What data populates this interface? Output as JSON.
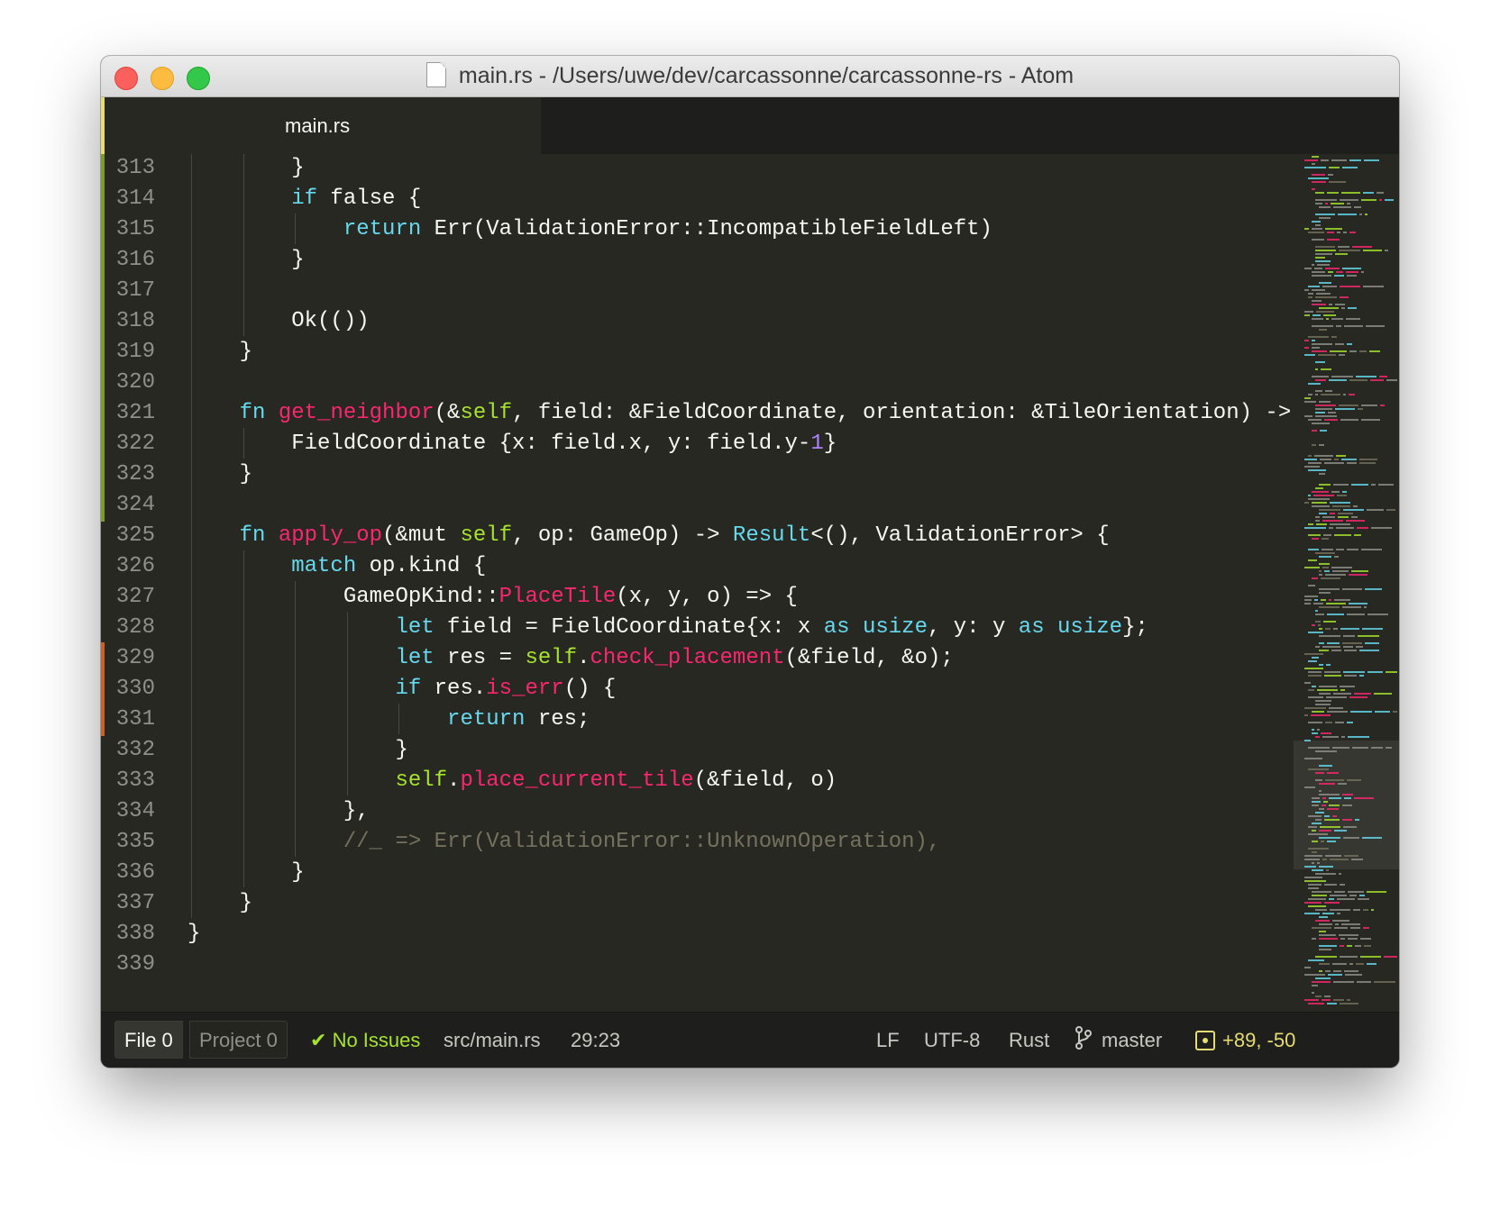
{
  "window": {
    "title": "main.rs - /Users/uwe/dev/carcassonne/carcassonne-rs - Atom"
  },
  "tabs": [
    {
      "label": "main.rs",
      "active": true
    }
  ],
  "editor": {
    "lines": [
      {
        "n": "313",
        "git": "added",
        "guides": [
          1,
          2
        ],
        "tokens": [
          [
            "t",
            "        }"
          ]
        ]
      },
      {
        "n": "314",
        "git": "added",
        "guides": [
          1,
          2
        ],
        "tokens": [
          [
            "t",
            "        "
          ],
          [
            "k",
            "if"
          ],
          [
            "t",
            " false {"
          ]
        ]
      },
      {
        "n": "315",
        "git": "added",
        "guides": [
          1,
          2,
          3
        ],
        "tokens": [
          [
            "t",
            "            "
          ],
          [
            "k",
            "return"
          ],
          [
            "t",
            " Err(ValidationError::IncompatibleFieldLeft)"
          ]
        ]
      },
      {
        "n": "316",
        "git": "added",
        "guides": [
          1,
          2
        ],
        "tokens": [
          [
            "t",
            "        }"
          ]
        ]
      },
      {
        "n": "317",
        "git": "added",
        "guides": [
          1,
          2
        ],
        "tokens": [
          [
            "t",
            ""
          ]
        ]
      },
      {
        "n": "318",
        "git": "added",
        "guides": [
          1,
          2
        ],
        "tokens": [
          [
            "t",
            "        Ok(())"
          ]
        ]
      },
      {
        "n": "319",
        "git": "added",
        "guides": [
          1
        ],
        "tokens": [
          [
            "t",
            "    }"
          ]
        ]
      },
      {
        "n": "320",
        "git": "added",
        "guides": [
          1
        ],
        "tokens": [
          [
            "t",
            ""
          ]
        ]
      },
      {
        "n": "321",
        "git": "added",
        "guides": [
          1
        ],
        "tokens": [
          [
            "t",
            "    "
          ],
          [
            "k",
            "fn"
          ],
          [
            "t",
            " "
          ],
          [
            "f",
            "get_neighbor"
          ],
          [
            "t",
            "(&"
          ],
          [
            "s",
            "self"
          ],
          [
            "t",
            ", field: &FieldCoordinate, orientation: &TileOrientation) -> &FieldCoordinate {"
          ]
        ]
      },
      {
        "n": "322",
        "git": "added",
        "guides": [
          1,
          2
        ],
        "tokens": [
          [
            "t",
            "        FieldCoordinate {x: field.x, y: field.y-"
          ],
          [
            "n",
            "1"
          ],
          [
            "t",
            "}"
          ]
        ]
      },
      {
        "n": "323",
        "git": "added",
        "guides": [
          1
        ],
        "tokens": [
          [
            "t",
            "    }"
          ]
        ]
      },
      {
        "n": "324",
        "git": "added",
        "guides": [
          1
        ],
        "tokens": [
          [
            "t",
            ""
          ]
        ]
      },
      {
        "n": "325",
        "git": "",
        "guides": [
          1
        ],
        "tokens": [
          [
            "t",
            "    "
          ],
          [
            "k",
            "fn"
          ],
          [
            "t",
            " "
          ],
          [
            "f",
            "apply_op"
          ],
          [
            "t",
            "(&mut "
          ],
          [
            "s",
            "self"
          ],
          [
            "t",
            ", op: GameOp) -> "
          ],
          [
            "k",
            "Result"
          ],
          [
            "t",
            "<(), ValidationError> {"
          ]
        ]
      },
      {
        "n": "326",
        "git": "",
        "guides": [
          1,
          2
        ],
        "tokens": [
          [
            "t",
            "        "
          ],
          [
            "k",
            "match"
          ],
          [
            "t",
            " op.kind {"
          ]
        ]
      },
      {
        "n": "327",
        "git": "",
        "guides": [
          1,
          2,
          3
        ],
        "tokens": [
          [
            "t",
            "            GameOpKind::"
          ],
          [
            "f",
            "PlaceTile"
          ],
          [
            "t",
            "(x, y, o) => {"
          ]
        ]
      },
      {
        "n": "328",
        "git": "",
        "guides": [
          1,
          2,
          3,
          4
        ],
        "tokens": [
          [
            "t",
            "                "
          ],
          [
            "k",
            "let"
          ],
          [
            "t",
            " field = FieldCoordinate{x: x "
          ],
          [
            "k",
            "as"
          ],
          [
            "t",
            " "
          ],
          [
            "k",
            "usize"
          ],
          [
            "t",
            ", y: y "
          ],
          [
            "k",
            "as"
          ],
          [
            "t",
            " "
          ],
          [
            "k",
            "usize"
          ],
          [
            "t",
            "};"
          ]
        ]
      },
      {
        "n": "329",
        "git": "modified",
        "guides": [
          1,
          2,
          3,
          4
        ],
        "tokens": [
          [
            "t",
            "                "
          ],
          [
            "k",
            "let"
          ],
          [
            "t",
            " res = "
          ],
          [
            "s",
            "self"
          ],
          [
            "t",
            "."
          ],
          [
            "f",
            "check_placement"
          ],
          [
            "t",
            "(&field, &o);"
          ]
        ]
      },
      {
        "n": "330",
        "git": "modified",
        "guides": [
          1,
          2,
          3,
          4
        ],
        "tokens": [
          [
            "t",
            "                "
          ],
          [
            "k",
            "if"
          ],
          [
            "t",
            " res."
          ],
          [
            "f",
            "is_err"
          ],
          [
            "t",
            "() {"
          ]
        ]
      },
      {
        "n": "331",
        "git": "modified",
        "guides": [
          1,
          2,
          3,
          4,
          5
        ],
        "tokens": [
          [
            "t",
            "                    "
          ],
          [
            "k",
            "return"
          ],
          [
            "t",
            " res;"
          ]
        ]
      },
      {
        "n": "332",
        "git": "",
        "guides": [
          1,
          2,
          3,
          4
        ],
        "tokens": [
          [
            "t",
            "                }"
          ]
        ]
      },
      {
        "n": "333",
        "git": "",
        "guides": [
          1,
          2,
          3,
          4
        ],
        "tokens": [
          [
            "t",
            "                "
          ],
          [
            "s",
            "self"
          ],
          [
            "t",
            "."
          ],
          [
            "f",
            "place_current_tile"
          ],
          [
            "t",
            "(&field, o)"
          ]
        ]
      },
      {
        "n": "334",
        "git": "",
        "guides": [
          1,
          2,
          3
        ],
        "tokens": [
          [
            "t",
            "            },"
          ]
        ]
      },
      {
        "n": "335",
        "git": "",
        "guides": [
          1,
          2,
          3
        ],
        "tokens": [
          [
            "t",
            "            "
          ],
          [
            "c",
            "//_ => Err(ValidationError::UnknownOperation),"
          ]
        ]
      },
      {
        "n": "336",
        "git": "",
        "guides": [
          1,
          2
        ],
        "tokens": [
          [
            "t",
            "        }"
          ]
        ]
      },
      {
        "n": "337",
        "git": "",
        "guides": [
          1
        ],
        "tokens": [
          [
            "t",
            "    }"
          ]
        ]
      },
      {
        "n": "338",
        "git": "",
        "guides": [],
        "tokens": [
          [
            "t",
            "}"
          ]
        ]
      },
      {
        "n": "339",
        "git": "",
        "guides": [],
        "tokens": [
          [
            "t",
            ""
          ]
        ]
      }
    ]
  },
  "statusbar": {
    "lint_file": "File 0",
    "lint_project": "Project 0",
    "issues": "No Issues",
    "path": "src/main.rs",
    "cursor": "29:23",
    "line_ending": "LF",
    "encoding": "UTF-8",
    "grammar": "Rust",
    "branch": "master",
    "git_changes": "+89, -50"
  },
  "colors": {
    "editor_bg": "#272822",
    "keyword": "#66d9ef",
    "function": "#f92672",
    "self": "#a6e22e",
    "number": "#ae81ff",
    "comment": "#75715e",
    "git_added": "#7c9a2d",
    "git_modified": "#c9622a"
  }
}
